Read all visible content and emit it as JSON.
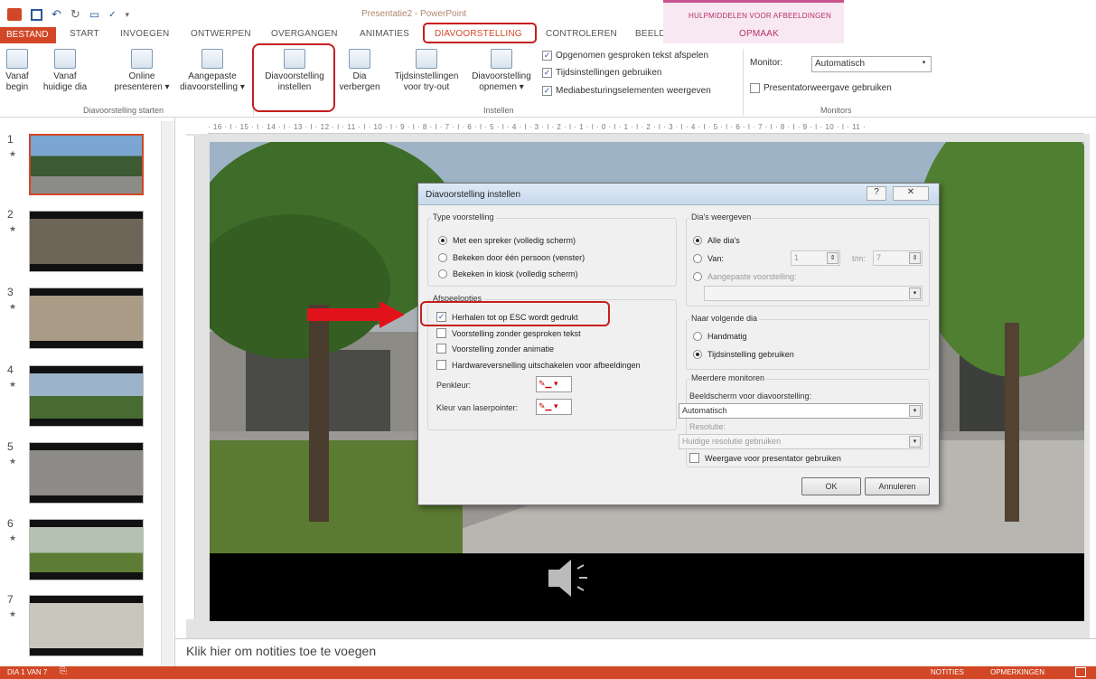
{
  "window": {
    "doc_title": "Presentatie2 - PowerPoint",
    "context_group": "HULPMIDDELEN VOOR AFBEELDINGEN"
  },
  "tabs": [
    "BESTAND",
    "START",
    "INVOEGEN",
    "ONTWERPEN",
    "OVERGANGEN",
    "ANIMATIES",
    "DIAVOORSTELLING",
    "CONTROLEREN",
    "BEELD"
  ],
  "context_tab": "OPMAAK",
  "ribbon": {
    "from_start": [
      "Vanaf",
      "begin"
    ],
    "from_current": [
      "Vanaf",
      "huidige dia"
    ],
    "online": [
      "Online",
      "presenteren ▾"
    ],
    "custom": [
      "Aangepaste",
      "diavoorstelling ▾"
    ],
    "group_start": "Diavoorstelling starten",
    "setup": [
      "Diavoorstelling",
      "instellen"
    ],
    "hide": [
      "Dia",
      "verbergen"
    ],
    "rehearse": [
      "Tijdsinstellingen",
      "voor try-out"
    ],
    "record": [
      "Diavoorstelling",
      "opnemen ▾"
    ],
    "cb_narration": "Opgenomen gesproken tekst afspelen",
    "cb_timings": "Tijdsinstellingen gebruiken",
    "cb_media": "Mediabesturingselementen weergeven",
    "group_setup": "Instellen",
    "monitor_label": "Monitor:",
    "monitor_value": "Automatisch",
    "presenter_view": "Presentatorweergave gebruiken",
    "group_monitors": "Monitors"
  },
  "slides": [
    {
      "num": "1",
      "star": "★"
    },
    {
      "num": "2",
      "star": "★"
    },
    {
      "num": "3",
      "star": "★"
    },
    {
      "num": "4",
      "star": "★"
    },
    {
      "num": "5",
      "star": "★"
    },
    {
      "num": "6",
      "star": "★"
    },
    {
      "num": "7",
      "star": "★"
    }
  ],
  "ruler_text": "· 16 · ǀ · 15 · ǀ · 14 · ǀ · 13 · ǀ · 12 · ǀ · 11 · ǀ · 10 · ǀ · 9 · ǀ · 8 · ǀ · 7 · ǀ · 6 · ǀ · 5 · ǀ · 4 · ǀ · 3 · ǀ · 2 · ǀ · 1 · ǀ · 0 · ǀ · 1 · ǀ · 2 · ǀ · 3 · ǀ · 4 · ǀ · 5 · ǀ · 6 · ǀ · 7 · ǀ · 8 · ǀ · 9 · ǀ · 10 · ǀ · 11 ·",
  "notes_placeholder": "Klik hier om notities toe te voegen",
  "status": {
    "slide": "DIA 1 VAN 7",
    "notes": "NOTITIES",
    "comments": "OPMERKINGEN"
  },
  "dialog": {
    "title": "Diavoorstelling instellen",
    "type_label": "Type voorstelling",
    "type_options": [
      "Met een spreker (volledig scherm)",
      "Bekeken door één persoon (venster)",
      "Bekeken in kiosk (volledig scherm)"
    ],
    "options_label": "Afspeelopties",
    "play_options": [
      "Herhalen tot op ESC wordt gedrukt",
      "Voorstelling zonder gesproken tekst",
      "Voorstelling zonder animatie",
      "Hardwareversnelling uitschakelen voor afbeeldingen"
    ],
    "pen_color": "Penkleur:",
    "laser_color": "Kleur van laserpointer:",
    "show_slides_label": "Dia's weergeven",
    "all_slides": "Alle dia's",
    "from_label": "Van:",
    "from_value": "1",
    "to_label": "t/m:",
    "to_value": "7",
    "custom_show": "Aangepaste voorstelling:",
    "advance_label": "Naar volgende dia",
    "manual": "Handmatig",
    "use_timings": "Tijdsinstelling gebruiken",
    "multi_monitor_label": "Meerdere monitoren",
    "screen_label": "Beeldscherm voor diavoorstelling:",
    "screen_value": "Automatisch",
    "resolution_label": "Resolutie:",
    "resolution_value": "Huidige resolutie gebruiken",
    "presenter_view": "Weergave voor presentator gebruiken",
    "ok": "OK",
    "cancel": "Annuleren"
  }
}
